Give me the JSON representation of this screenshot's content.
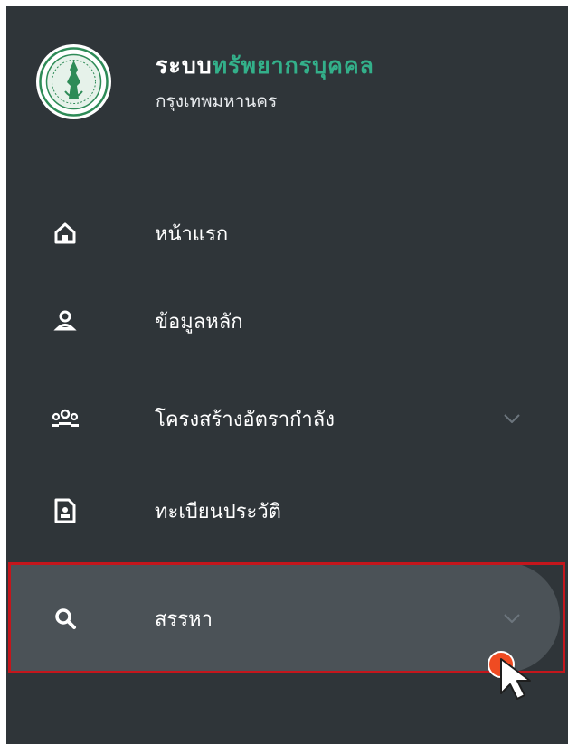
{
  "brand": {
    "title_part1": "ระบบ",
    "title_part2": "ทรัพยากรบุคคล",
    "subtitle": "กรุงเทพมหานคร",
    "logo_icon": "bangkok-seal-icon"
  },
  "colors": {
    "sidebar_bg": "#2f3539",
    "accent_green": "#33b08a",
    "active_bg": "#4b5257",
    "highlight_border": "#c4161c",
    "cursor_dot": "#ef4b22"
  },
  "nav": {
    "items": [
      {
        "label": "หน้าแรก",
        "icon": "home-icon",
        "has_submenu": false
      },
      {
        "label": "ข้อมูลหลัก",
        "icon": "user-icon",
        "has_submenu": false
      },
      {
        "label": "โครงสร้างอัตรากำลัง",
        "icon": "group-icon",
        "has_submenu": true
      },
      {
        "label": "ทะเบียนประวัติ",
        "icon": "profile-document-icon",
        "has_submenu": false
      },
      {
        "label": "สรรหา",
        "icon": "search-icon",
        "has_submenu": true,
        "active": true
      }
    ]
  }
}
